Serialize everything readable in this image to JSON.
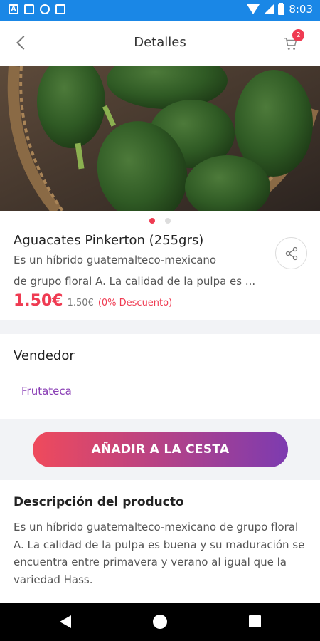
{
  "status_bar": {
    "time": "8:03"
  },
  "header": {
    "title": "Detalles",
    "cart_count": "2"
  },
  "product": {
    "name": "Aguacates Pinkerton (255grs)",
    "desc_line1": "Es  un híbrido guatemalteco-mexicano",
    "desc_line2": "de grupo floral A. La calidad de la pulpa es ...",
    "price": "1.50€",
    "old_price": "1.50€",
    "discount": "(0% Descuento)",
    "carousel": {
      "count": 2,
      "active": 1
    }
  },
  "seller_section": {
    "title": "Vendedor",
    "name": "Frutateca"
  },
  "add_to_cart": {
    "label": "AÑADIR A LA CESTA"
  },
  "description": {
    "title": "Descripción del producto",
    "text": "Es  un híbrido guatemalteco-mexicano de grupo floral A. La calidad de la pulpa es buena y su maduración se encuentra entre primavera y verano al igual que la variedad Hass."
  },
  "colors": {
    "accent": "#ef3b52",
    "purple": "#7d3bb0",
    "status_bar": "#1a87e6"
  }
}
